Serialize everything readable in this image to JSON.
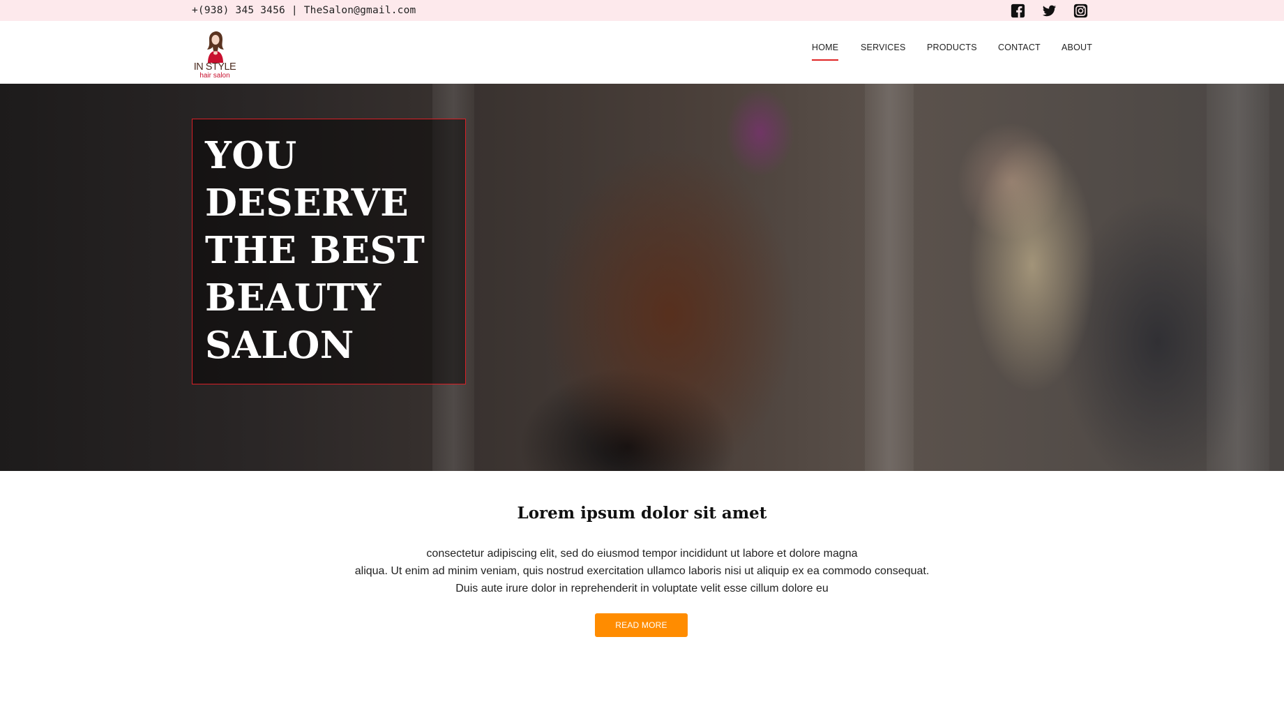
{
  "topbar": {
    "contact_text": "+(938) 345 3456 | TheSalon@gmail.com",
    "social_icons": [
      "facebook-icon",
      "twitter-icon",
      "instagram-icon"
    ]
  },
  "header": {
    "logo_title": "IN STYLE",
    "logo_subtitle": "hair salon",
    "nav": [
      {
        "label": "HOME",
        "active": true
      },
      {
        "label": "SERVICES"
      },
      {
        "label": "PRODUCTS"
      },
      {
        "label": "CONTACT"
      },
      {
        "label": "ABOUT"
      }
    ]
  },
  "hero": {
    "headline_lines": [
      "YOU",
      "DESERVE",
      "THE BEST",
      "BEAUTY",
      "SALON"
    ]
  },
  "intro": {
    "title": "Lorem ipsum dolor sit amet",
    "lines": [
      "consectetur adipiscing elit, sed do eiusmod tempor incididunt ut labore et dolore magna",
      "aliqua. Ut enim ad minim veniam, quis nostrud exercitation ullamco laboris nisi ut aliquip ex ea commodo consequat.",
      "Duis aute irure dolor in reprehenderit in voluptate velit esse cillum dolore eu"
    ],
    "button_label": "READ MORE"
  },
  "colors": {
    "topbar_bg": "#fde9ec",
    "accent_red": "#d91f26",
    "button_orange": "#ff8c00"
  }
}
